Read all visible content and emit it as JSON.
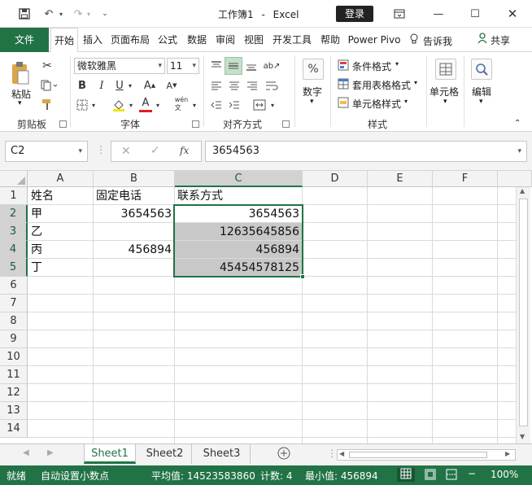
{
  "title": {
    "document": "工作簿1",
    "separator": "-",
    "app": "Excel",
    "login": "登录"
  },
  "ribbon_tabs": [
    "开始",
    "插入",
    "页面布局",
    "公式",
    "数据",
    "审阅",
    "视图",
    "开发工具",
    "帮助",
    "Power Pivo"
  ],
  "file_tab": "文件",
  "tell_me": "告诉我",
  "share": "共享",
  "clipboard": {
    "paste": "粘贴",
    "label": "剪贴板"
  },
  "font": {
    "name": "微软雅黑",
    "size": "11",
    "label": "字体"
  },
  "alignment": {
    "label": "对齐方式"
  },
  "number": {
    "label": "数字"
  },
  "styles": {
    "conditional": "条件格式",
    "table": "套用表格格式",
    "cell": "单元格样式",
    "label": "样式"
  },
  "cells": {
    "label": "单元格"
  },
  "editing": {
    "label": "编辑"
  },
  "formula_bar": {
    "name_box": "C2",
    "fx": "fx",
    "content": "3654563"
  },
  "columns": [
    "A",
    "B",
    "C",
    "D",
    "E",
    "F"
  ],
  "rows": [
    "1",
    "2",
    "3",
    "4",
    "5",
    "6",
    "7",
    "8",
    "9",
    "10",
    "11",
    "12",
    "13",
    "14"
  ],
  "cells_data": {
    "A1": "姓名",
    "B1": "固定电话",
    "C1": "联系方式",
    "A2": "甲",
    "B2": "3654563",
    "C2": "3654563",
    "A3": "乙",
    "C3": "12635645856",
    "A4": "丙",
    "B4": "456894",
    "C4": "456894",
    "A5": "丁",
    "C5": "45454578125"
  },
  "sheets": [
    "Sheet1",
    "Sheet2",
    "Sheet3"
  ],
  "status": {
    "ready": "就绪",
    "auto_decimal": "自动设置小数点",
    "average": "平均值: 14523583860",
    "count": "计数: 4",
    "min": "最小值: 456894",
    "zoom": "100%"
  },
  "colors": {
    "accent": "#217346"
  }
}
